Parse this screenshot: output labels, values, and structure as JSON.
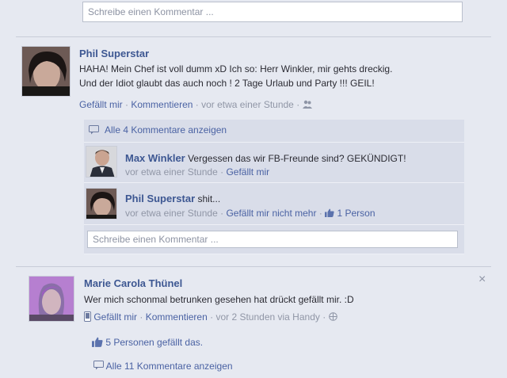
{
  "top_comment_input": {
    "placeholder": "Schreibe einen Kommentar ..."
  },
  "post1": {
    "author": "Phil Superstar",
    "text_line1": "HAHA! Mein Chef ist voll dumm xD Ich so: Herr Winkler, mir gehts dreckig.",
    "text_line2": "Und der Idiot glaubt das auch noch ! 2 Tage Urlaub und Party !!! GEIL!",
    "like": "Gefällt mir",
    "comment": "Kommentieren",
    "time": "vor etwa einer Stunde",
    "sep": "·",
    "show_all_comments": "Alle 4 Kommentare anzeigen",
    "comments": [
      {
        "author": "Max Winkler",
        "text": "Vergessen das wir FB-Freunde sind? GEKÜNDIGT!",
        "time": "vor etwa einer Stunde",
        "action": "Gefällt mir",
        "likes": ""
      },
      {
        "author": "Phil Superstar",
        "text": "shit...",
        "time": "vor etwa einer Stunde",
        "action": "Gefällt mir nicht mehr",
        "likes": "1 Person"
      }
    ],
    "comment_input_placeholder": "Schreibe einen Kommentar ..."
  },
  "post2": {
    "author": "Marie Carola Thünel",
    "text": "Wer mich schonmal betrunken gesehen hat drückt gefällt mir. :D",
    "like": "Gefällt mir",
    "comment": "Kommentieren",
    "time": "vor 2 Stunden via Handy",
    "sep": "·",
    "likes_summary": "5 Personen gefällt das.",
    "show_all_comments": "Alle 11 Kommentare anzeigen",
    "close": "×"
  },
  "colors": {
    "link": "#4a62a3",
    "background": "#e6e9f1",
    "comment_box": "#d9dde9"
  }
}
